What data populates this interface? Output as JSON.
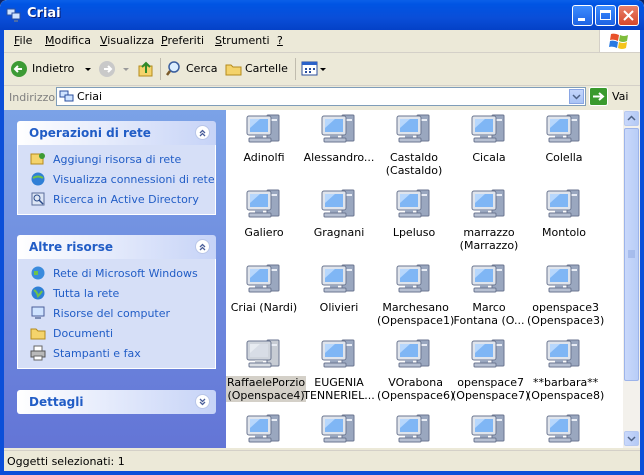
{
  "window": {
    "title": "Criai"
  },
  "menu": [
    {
      "label": "File",
      "underline": "F",
      "rest": "ile"
    },
    {
      "label": "Modifica",
      "underline": "M",
      "rest": "odifica"
    },
    {
      "label": "Visualizza",
      "underline": "V",
      "rest": "isualizza"
    },
    {
      "label": "Preferiti",
      "underline": "P",
      "rest": "referiti"
    },
    {
      "label": "Strumenti",
      "underline": "S",
      "rest": "trumenti"
    },
    {
      "label": "?",
      "underline": "?",
      "rest": ""
    }
  ],
  "toolbar": {
    "back": "Indietro",
    "search": "Cerca",
    "folders": "Cartelle"
  },
  "address": {
    "label": "Indirizzo",
    "value": "Criai",
    "go": "Vai"
  },
  "panels": {
    "network_tasks": {
      "title": "Operazioni di rete",
      "items": [
        "Aggiungi risorsa di rete",
        "Visualizza connessioni di rete",
        "Ricerca in Active Directory"
      ]
    },
    "other_places": {
      "title": "Altre risorse",
      "items": [
        "Rete di Microsoft Windows",
        "Tutta la rete",
        "Risorse del computer",
        "Documenti",
        "Stampanti e fax"
      ]
    },
    "details": {
      "title": "Dettagli"
    }
  },
  "computers": [
    {
      "l1": "Adinolfi",
      "l2": ""
    },
    {
      "l1": "Alessandro...",
      "l2": ""
    },
    {
      "l1": "Castaldo",
      "l2": "(Castaldo)"
    },
    {
      "l1": "Cicala",
      "l2": ""
    },
    {
      "l1": "Colella",
      "l2": ""
    },
    {
      "l1": "Galiero",
      "l2": ""
    },
    {
      "l1": "Gragnani",
      "l2": ""
    },
    {
      "l1": "Lpeluso",
      "l2": ""
    },
    {
      "l1": "marrazzo",
      "l2": "(Marrazzo)"
    },
    {
      "l1": "Montolo",
      "l2": ""
    },
    {
      "l1": "Criai (Nardi)",
      "l2": ""
    },
    {
      "l1": "Olivieri",
      "l2": ""
    },
    {
      "l1": "Marchesano",
      "l2": "(Openspace1)"
    },
    {
      "l1": "Marco",
      "l2": "Fontana (O..."
    },
    {
      "l1": "openspace3",
      "l2": "(Openspace3)"
    },
    {
      "l1": "RaffaelePorzio",
      "l2": "(Openspace4)",
      "selected": true
    },
    {
      "l1": "EUGENIA",
      "l2": "TENNERIEL..."
    },
    {
      "l1": "VOrabona",
      "l2": "(Openspace6)"
    },
    {
      "l1": "openspace7",
      "l2": "(Openspace7)"
    },
    {
      "l1": "**barbara**",
      "l2": "(Openspace8)"
    },
    {
      "l1": "",
      "l2": ""
    },
    {
      "l1": "",
      "l2": ""
    },
    {
      "l1": "",
      "l2": ""
    },
    {
      "l1": "",
      "l2": ""
    },
    {
      "l1": "",
      "l2": ""
    }
  ],
  "status": {
    "text": "Oggetti selezionati: 1"
  },
  "colors": {
    "title_blue": "#0054e3",
    "task_link": "#215dc6",
    "selection_gray": "#d4d0c8"
  }
}
